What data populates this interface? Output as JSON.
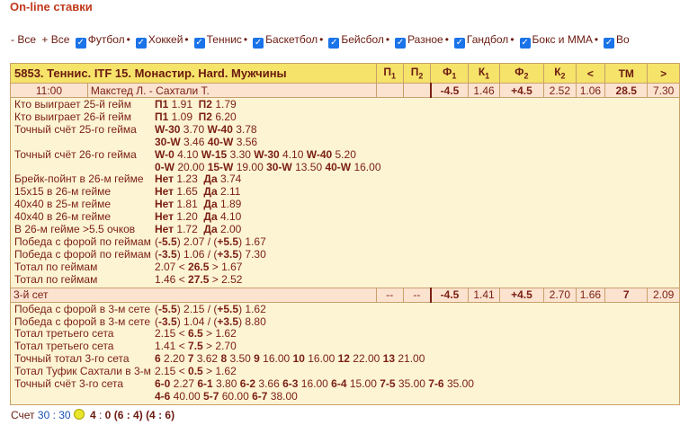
{
  "title": "On-line ставки",
  "filters": {
    "none": "- Все",
    "all": "+ Все",
    "items": [
      "Футбол",
      "Хоккей",
      "Теннис",
      "Баскетбол",
      "Бейсбол",
      "Разное",
      "Гандбол",
      "Бокс и ММА",
      "Во"
    ]
  },
  "header": {
    "title": "5853. Теннис. ITF 15. Монастир. Hard. Мужчины",
    "p1": "П",
    "p1_sub": "1",
    "p2": "П",
    "p2_sub": "2",
    "f1": "Ф",
    "f1_sub": "1",
    "k1": "К",
    "k1_sub": "1",
    "f2": "Ф",
    "f2_sub": "2",
    "k2": "К",
    "k2_sub": "2",
    "lt": "<",
    "tm": "ТМ",
    "gt": ">"
  },
  "match": {
    "time": "11:00",
    "teams": "Макстед Л. - Сахтали Т.",
    "p1": "",
    "p2": "",
    "f1": "-4.5",
    "k1": "1.46",
    "f2": "+4.5",
    "k2": "2.52",
    "lt": "1.06",
    "tm": "28.5",
    "gt": "7.30"
  },
  "details1": [
    {
      "label": "Кто выиграет 25-й гейм",
      "parts": [
        [
          "b",
          "П1"
        ],
        [
          "t",
          " 1.91  "
        ],
        [
          "b",
          "П2"
        ],
        [
          "t",
          " 1.79"
        ]
      ]
    },
    {
      "label": "Кто выиграет 26-й гейм",
      "parts": [
        [
          "b",
          "П1"
        ],
        [
          "t",
          " 1.09  "
        ],
        [
          "b",
          "П2"
        ],
        [
          "t",
          " 6.20"
        ]
      ]
    },
    {
      "label": "Точный счёт 25-го гейма",
      "parts": [
        [
          "b",
          "W-30"
        ],
        [
          "t",
          " 3.70 "
        ],
        [
          "b",
          "W-40"
        ],
        [
          "t",
          " 3.78"
        ]
      ]
    },
    {
      "label": "",
      "parts": [
        [
          "b",
          "30-W"
        ],
        [
          "t",
          " 3.46 "
        ],
        [
          "b",
          "40-W"
        ],
        [
          "t",
          " 3.56"
        ]
      ]
    },
    {
      "label": "Точный счёт 26-го гейма",
      "parts": [
        [
          "b",
          "W-0"
        ],
        [
          "t",
          " 4.10 "
        ],
        [
          "b",
          "W-15"
        ],
        [
          "t",
          " 3.30 "
        ],
        [
          "b",
          "W-30"
        ],
        [
          "t",
          " 4.10 "
        ],
        [
          "b",
          "W-40"
        ],
        [
          "t",
          " 5.20"
        ]
      ]
    },
    {
      "label": "",
      "parts": [
        [
          "b",
          "0-W"
        ],
        [
          "t",
          " 20.00 "
        ],
        [
          "b",
          "15-W"
        ],
        [
          "t",
          " 19.00 "
        ],
        [
          "b",
          "30-W"
        ],
        [
          "t",
          " 13.50 "
        ],
        [
          "b",
          "40-W"
        ],
        [
          "t",
          " 16.00"
        ]
      ]
    },
    {
      "label": "Брейк-пойнт в 26-м гейме",
      "parts": [
        [
          "b",
          "Нет"
        ],
        [
          "t",
          " 1.23  "
        ],
        [
          "b",
          "Да"
        ],
        [
          "t",
          " 3.74"
        ]
      ]
    },
    {
      "label": "15x15 в 26-м гейме",
      "parts": [
        [
          "b",
          "Нет"
        ],
        [
          "t",
          " 1.65  "
        ],
        [
          "b",
          "Да"
        ],
        [
          "t",
          " 2.11"
        ]
      ]
    },
    {
      "label": "40x40 в 25-м гейме",
      "parts": [
        [
          "b",
          "Нет"
        ],
        [
          "t",
          " 1.81  "
        ],
        [
          "b",
          "Да"
        ],
        [
          "t",
          " 1.89"
        ]
      ]
    },
    {
      "label": "40x40 в 26-м гейме",
      "parts": [
        [
          "b",
          "Нет"
        ],
        [
          "t",
          " 1.20  "
        ],
        [
          "b",
          "Да"
        ],
        [
          "t",
          " 4.10"
        ]
      ]
    },
    {
      "label": "В 26-м гейме >5.5 очков",
      "parts": [
        [
          "b",
          "Нет"
        ],
        [
          "t",
          " 1.72  "
        ],
        [
          "b",
          "Да"
        ],
        [
          "t",
          " 2.00"
        ]
      ]
    },
    {
      "label": "Победа с форой по геймам",
      "parts": [
        [
          "t",
          "("
        ],
        [
          "b",
          "-5.5"
        ],
        [
          "t",
          ") 2.07 / ("
        ],
        [
          "b",
          "+5.5"
        ],
        [
          "t",
          ") 1.67"
        ]
      ]
    },
    {
      "label": "Победа с форой по геймам",
      "parts": [
        [
          "t",
          "("
        ],
        [
          "b",
          "-3.5"
        ],
        [
          "t",
          ") 1.06 / ("
        ],
        [
          "b",
          "+3.5"
        ],
        [
          "t",
          ") 7.30"
        ]
      ]
    },
    {
      "label": "Тотал по геймам",
      "parts": [
        [
          "t",
          "2.07 < "
        ],
        [
          "b",
          "26.5"
        ],
        [
          "t",
          " > 1.67"
        ]
      ]
    },
    {
      "label": "Тотал по геймам",
      "parts": [
        [
          "t",
          "1.46 < "
        ],
        [
          "b",
          "27.5"
        ],
        [
          "t",
          " > 2.52"
        ]
      ]
    }
  ],
  "set": {
    "name": "3-й сет",
    "p1": "--",
    "p2": "--",
    "f1": "-4.5",
    "k1": "1.41",
    "f2": "+4.5",
    "k2": "2.70",
    "lt": "1.66",
    "tm": "7",
    "gt": "2.09"
  },
  "details2": [
    {
      "label": "Победа с форой в 3-м сете",
      "parts": [
        [
          "t",
          "("
        ],
        [
          "b",
          "-5.5"
        ],
        [
          "t",
          ") 2.15 / ("
        ],
        [
          "b",
          "+5.5"
        ],
        [
          "t",
          ") 1.62"
        ]
      ]
    },
    {
      "label": "Победа с форой в 3-м сете",
      "parts": [
        [
          "t",
          "("
        ],
        [
          "b",
          "-3.5"
        ],
        [
          "t",
          ") 1.04 / ("
        ],
        [
          "b",
          "+3.5"
        ],
        [
          "t",
          ") 8.80"
        ]
      ]
    },
    {
      "label": "Тотал третьего сета",
      "parts": [
        [
          "t",
          "2.15 < "
        ],
        [
          "b",
          "6.5"
        ],
        [
          "t",
          " > 1.62"
        ]
      ]
    },
    {
      "label": "Тотал третьего сета",
      "parts": [
        [
          "t",
          "1.41 < "
        ],
        [
          "b",
          "7.5"
        ],
        [
          "t",
          " > 2.70"
        ]
      ]
    },
    {
      "label": "Точный тотал 3-го сета",
      "parts": [
        [
          "b",
          "6"
        ],
        [
          "t",
          " 2.20 "
        ],
        [
          "b",
          "7"
        ],
        [
          "t",
          " 3.62 "
        ],
        [
          "b",
          "8"
        ],
        [
          "t",
          " 3.50 "
        ],
        [
          "b",
          "9"
        ],
        [
          "t",
          " 16.00 "
        ],
        [
          "b",
          "10"
        ],
        [
          "t",
          " 16.00 "
        ],
        [
          "b",
          "12"
        ],
        [
          "t",
          " 22.00 "
        ],
        [
          "b",
          "13"
        ],
        [
          "t",
          " 21.00"
        ]
      ]
    },
    {
      "label": "Тотал Туфик Сахтали в 3-м сете",
      "parts": [
        [
          "t",
          "2.15 < "
        ],
        [
          "b",
          "0.5"
        ],
        [
          "t",
          " > 1.62"
        ]
      ]
    },
    {
      "label": "Точный счёт 3-го сета",
      "parts": [
        [
          "b",
          "6-0"
        ],
        [
          "t",
          " 2.27 "
        ],
        [
          "b",
          "6-1"
        ],
        [
          "t",
          " 3.80 "
        ],
        [
          "b",
          "6-2"
        ],
        [
          "t",
          " 3.66 "
        ],
        [
          "b",
          "6-3"
        ],
        [
          "t",
          " 16.00 "
        ],
        [
          "b",
          "6-4"
        ],
        [
          "t",
          " 15.00 "
        ],
        [
          "b",
          "7-5"
        ],
        [
          "t",
          " 35.00 "
        ],
        [
          "b",
          "7-6"
        ],
        [
          "t",
          " 35.00"
        ]
      ]
    },
    {
      "label": "",
      "parts": [
        [
          "b",
          "4-6"
        ],
        [
          "t",
          " 40.00 "
        ],
        [
          "b",
          "5-7"
        ],
        [
          "t",
          " 60.00 "
        ],
        [
          "b",
          "6-7"
        ],
        [
          "t",
          " 38.00"
        ]
      ]
    }
  ],
  "footer": {
    "label": "Счет",
    "points": "30 : 30",
    "games_a": "4",
    "games_sep": ":",
    "games_b": "0",
    "set1": "(6 : 4)",
    "set2": "(4 : 6)"
  }
}
